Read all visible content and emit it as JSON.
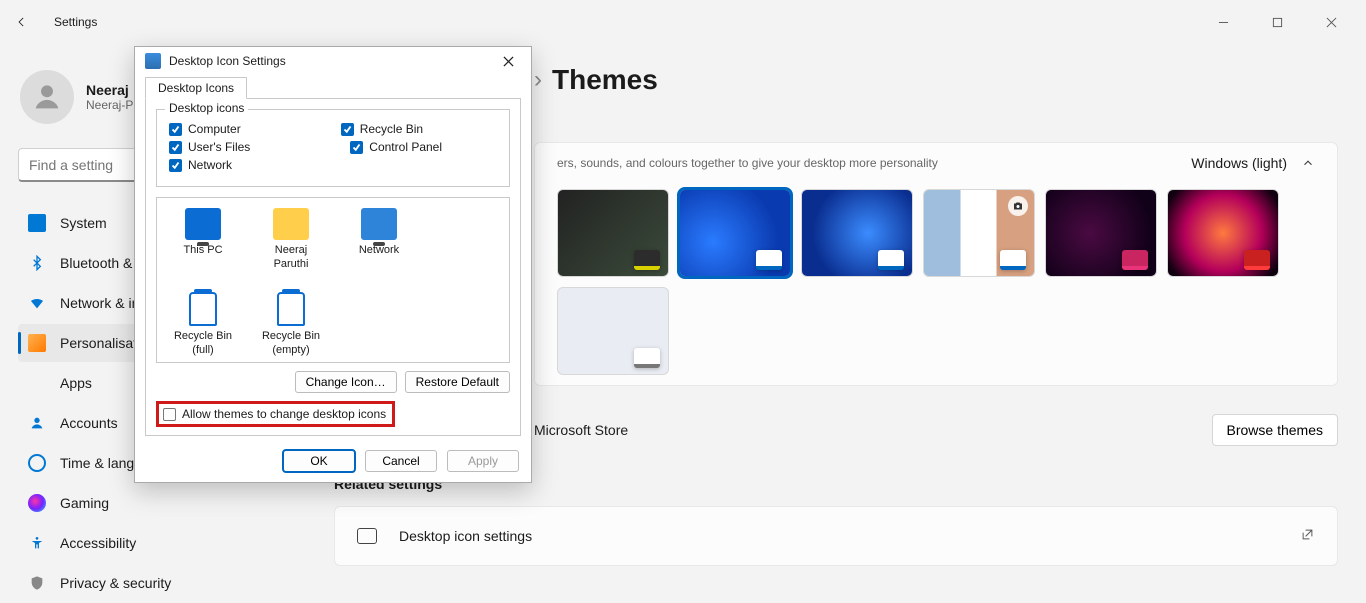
{
  "app_title": "Settings",
  "user": {
    "name": "Neeraj",
    "email": "Neeraj-P"
  },
  "search": {
    "placeholder": "Find a setting"
  },
  "nav": {
    "system": "System",
    "bluetooth": "Bluetooth & devices",
    "network": "Network & internet",
    "personalisation": "Personalisation",
    "apps": "Apps",
    "accounts": "Accounts",
    "time": "Time & language",
    "gaming": "Gaming",
    "accessibility": "Accessibility",
    "privacy": "Privacy & security"
  },
  "breadcrumb": {
    "current": "Themes"
  },
  "banner": {
    "subtitle": "ers, sounds, and colours together to give your desktop more personality",
    "current_theme": "Windows (light)"
  },
  "store_text": "Microsoft Store",
  "browse_button": "Browse themes",
  "related": {
    "header": "Related settings",
    "item1": "Desktop icon settings"
  },
  "dialog": {
    "title": "Desktop Icon Settings",
    "tab": "Desktop Icons",
    "group_title": "Desktop icons",
    "cb_computer": "Computer",
    "cb_recycle": "Recycle Bin",
    "cb_userfiles": "User's Files",
    "cb_controlpanel": "Control Panel",
    "cb_network": "Network",
    "icons": {
      "thispc": "This PC",
      "user": "Neeraj Paruthi",
      "network": "Network",
      "binfull": "Recycle Bin (full)",
      "binempty": "Recycle Bin (empty)"
    },
    "change_icon": "Change Icon…",
    "restore_default": "Restore Default",
    "allow_themes": "Allow themes to change desktop icons",
    "ok": "OK",
    "cancel": "Cancel",
    "apply": "Apply"
  }
}
